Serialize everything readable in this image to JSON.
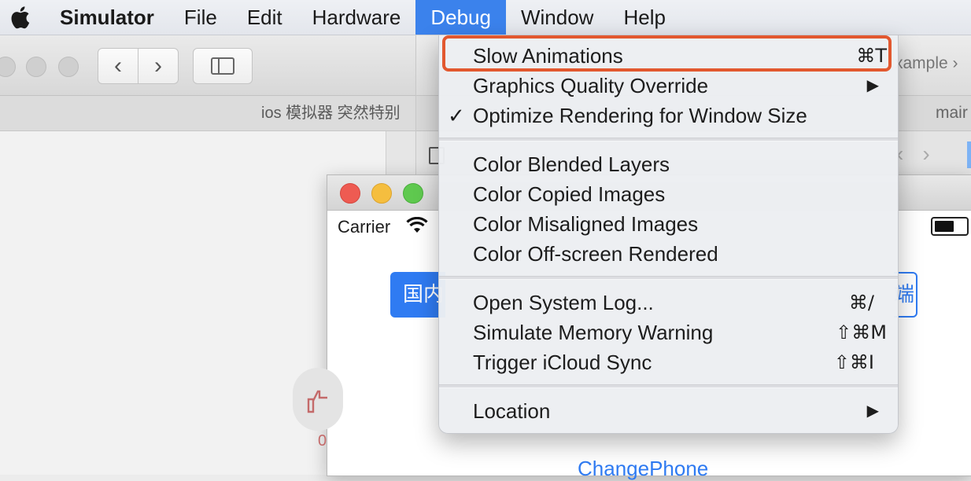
{
  "menubar": {
    "apple_icon": "apple-logo-icon",
    "app_name": "Simulator",
    "items": [
      "File",
      "Edit",
      "Hardware",
      "Debug",
      "Window",
      "Help"
    ],
    "active": "Debug",
    "active_color": "#3b82ec"
  },
  "background_window": {
    "tab_title": "ios 模拟器 突然特别",
    "breadcrumb": "xample",
    "tab_label": "mair"
  },
  "simulator": {
    "carrier": "Carrier",
    "segment_left": "国内",
    "segment_right": "端",
    "change_phone": "ChangePhone",
    "like_count": "0"
  },
  "debug_menu": {
    "slow_animations": {
      "label": "Slow Animations",
      "shortcut": "⌘T"
    },
    "graphics_quality": {
      "label": "Graphics Quality Override",
      "submenu": "▶"
    },
    "optimize_rendering": {
      "label": "Optimize Rendering for Window Size",
      "check": "✓"
    },
    "color_blended": {
      "label": "Color Blended Layers"
    },
    "color_copied": {
      "label": "Color Copied Images"
    },
    "color_misaligned": {
      "label": "Color Misaligned Images"
    },
    "color_offscreen": {
      "label": "Color Off-screen Rendered"
    },
    "open_system_log": {
      "label": "Open System Log...",
      "shortcut": "⌘/"
    },
    "simulate_memory": {
      "label": "Simulate Memory Warning",
      "shortcut": "⇧⌘M"
    },
    "trigger_icloud": {
      "label": "Trigger iCloud Sync",
      "shortcut": "⇧⌘I"
    },
    "location": {
      "label": "Location",
      "submenu": "▶"
    }
  },
  "highlight_color": "#e2582f"
}
